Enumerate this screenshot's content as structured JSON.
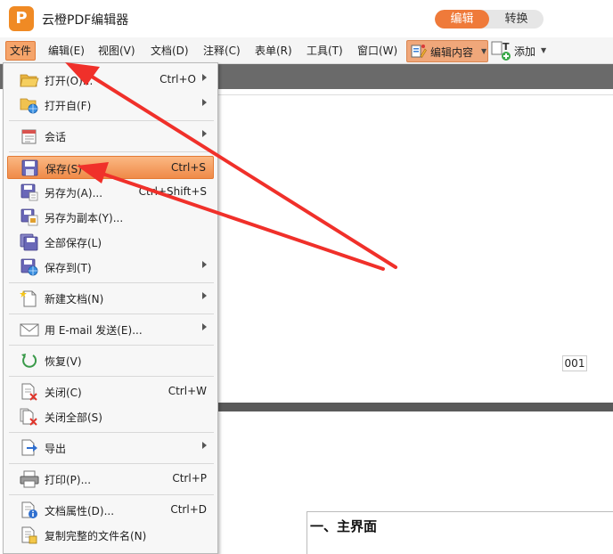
{
  "app": {
    "title": "云橙PDF编辑器",
    "logo_letter": "P"
  },
  "mode_switch": {
    "edit": "编辑",
    "convert": "转换"
  },
  "menubar": {
    "items": [
      "文件",
      "编辑(E)",
      "视图(V)",
      "文档(D)",
      "注释(C)",
      "表单(R)",
      "工具(T)",
      "窗口(W)"
    ],
    "edit_content": "编辑内容",
    "add": "添加"
  },
  "file_menu": {
    "items": [
      {
        "label": "打开(O)...",
        "shortcut": "Ctrl+O",
        "submenu": true
      },
      {
        "label": "打开自(F)",
        "shortcut": "",
        "submenu": true
      },
      {
        "label": "会话",
        "shortcut": "",
        "submenu": true
      },
      {
        "label": "保存(S)",
        "shortcut": "Ctrl+S",
        "submenu": false
      },
      {
        "label": "另存为(A)...",
        "shortcut": "Ctrl+Shift+S",
        "submenu": false
      },
      {
        "label": "另存为副本(Y)...",
        "shortcut": "",
        "submenu": false
      },
      {
        "label": "全部保存(L)",
        "shortcut": "",
        "submenu": false
      },
      {
        "label": "保存到(T)",
        "shortcut": "",
        "submenu": true
      },
      {
        "label": "新建文档(N)",
        "shortcut": "",
        "submenu": true
      },
      {
        "label": "用 E-mail 发送(E)...",
        "shortcut": "",
        "submenu": true
      },
      {
        "label": "恢复(V)",
        "shortcut": "",
        "submenu": false
      },
      {
        "label": "关闭(C)",
        "shortcut": "Ctrl+W",
        "submenu": false
      },
      {
        "label": "关闭全部(S)",
        "shortcut": "",
        "submenu": false
      },
      {
        "label": "导出",
        "shortcut": "",
        "submenu": true
      },
      {
        "label": "打印(P)...",
        "shortcut": "Ctrl+P",
        "submenu": false
      },
      {
        "label": "文档属性(D)...",
        "shortcut": "Ctrl+D",
        "submenu": false
      },
      {
        "label": "复制完整的文件名(N)",
        "shortcut": "",
        "submenu": false
      }
    ]
  },
  "document": {
    "page_number": "001",
    "section_heading": "一、主界面"
  },
  "icons": {
    "open": "folder-open-icon",
    "open_from": "folder-globe-icon",
    "session": "calendar-icon",
    "save": "floppy-disk-icon",
    "save_as": "floppy-disk-pencil-icon",
    "save_copy": "floppy-disk-copy-icon",
    "save_all": "floppy-disk-stack-icon",
    "save_to": "floppy-disk-globe-icon",
    "new_doc": "new-document-icon",
    "email": "envelope-icon",
    "revert": "revert-arrow-icon",
    "close": "document-close-icon",
    "close_all": "documents-close-icon",
    "export": "export-arrow-icon",
    "print": "printer-icon",
    "properties": "document-info-icon",
    "copy_name": "document-copy-icon"
  },
  "colors": {
    "accent_orange": "#ef7a3a",
    "highlight_orange": "#f5a46a",
    "annotation_red": "#f0302a"
  }
}
